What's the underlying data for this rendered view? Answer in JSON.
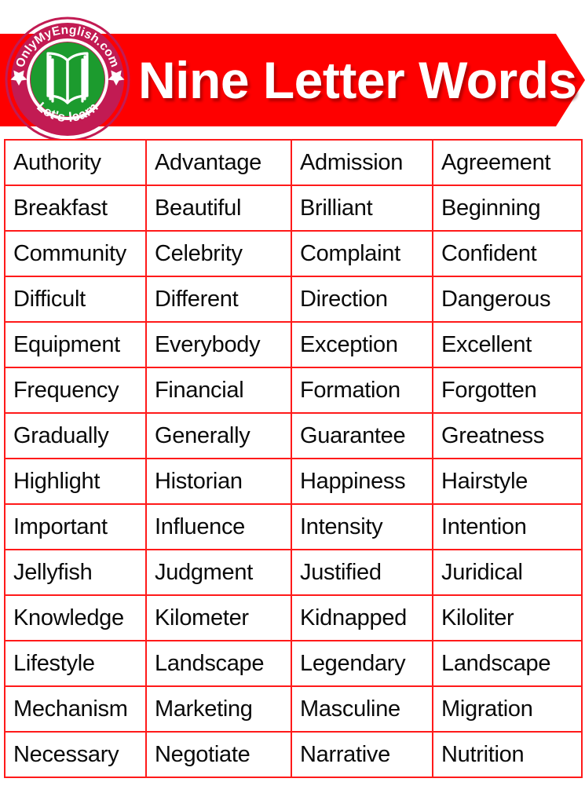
{
  "header": {
    "title": "Nine Letter Words",
    "banner_color": "#FE0000",
    "title_color": "#FFFFFF",
    "logo": {
      "top_text": "OnlyMyEnglish.com",
      "bottom_text": "Let's learn",
      "ring_color": "#C21B53",
      "center_color": "#1C9B2E",
      "icon": "open-book-icon",
      "left_star": "star-icon",
      "right_star": "star-icon"
    }
  },
  "table": {
    "border_color": "#FF1A1A",
    "text_color": "#0A0A0A",
    "columns": 4,
    "rows": [
      [
        "Authority",
        "Advantage",
        "Admission",
        "Agreement"
      ],
      [
        "Breakfast",
        "Beautiful",
        "Brilliant",
        "Beginning"
      ],
      [
        "Community",
        "Celebrity",
        "Complaint",
        "Confident"
      ],
      [
        "Difficult",
        "Different",
        "Direction",
        "Dangerous"
      ],
      [
        "Equipment",
        "Everybody",
        "Exception",
        "Excellent"
      ],
      [
        "Frequency",
        "Financial",
        "Formation",
        "Forgotten"
      ],
      [
        "Gradually",
        "Generally",
        "Guarantee",
        "Greatness"
      ],
      [
        "Highlight",
        "Historian",
        "Happiness",
        "Hairstyle"
      ],
      [
        "Important",
        "Influence",
        "Intensity",
        "Intention"
      ],
      [
        "Jellyfish",
        "Judgment",
        "Justified",
        "Juridical"
      ],
      [
        "Knowledge",
        "Kilometer",
        "Kidnapped",
        "Kiloliter"
      ],
      [
        "Lifestyle",
        "Landscape",
        "Legendary",
        "Landscape"
      ],
      [
        "Mechanism",
        "Marketing",
        "Masculine",
        "Migration"
      ],
      [
        "Necessary",
        "Negotiate",
        "Narrative",
        "Nutrition"
      ]
    ]
  }
}
